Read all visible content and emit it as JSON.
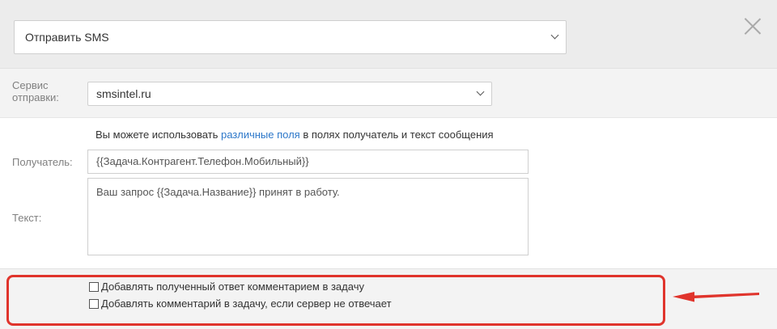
{
  "action": {
    "selected": "Отправить SMS"
  },
  "service": {
    "label": "Сервис отправки:",
    "selected": "smsintel.ru"
  },
  "hint": {
    "before": "Вы можете использовать ",
    "link": "различные поля",
    "after": " в полях получатель и текст сообщения"
  },
  "recipient": {
    "label": "Получатель:",
    "value": "{{Задача.Контрагент.Телефон.Мобильный}}"
  },
  "text": {
    "label": "Текст:",
    "value": "Ваш запрос {{Задача.Название}} принят в работу."
  },
  "options": [
    {
      "label": "Добавлять полученный ответ комментарием в задачу",
      "checked": false
    },
    {
      "label": "Добавлять комментарий в задачу, если сервер не отвечает",
      "checked": false
    }
  ],
  "colors": {
    "highlight": "#e0342c",
    "link": "#2c77c9",
    "header_bg": "#ececec",
    "band_bg": "#f3f3f3"
  }
}
